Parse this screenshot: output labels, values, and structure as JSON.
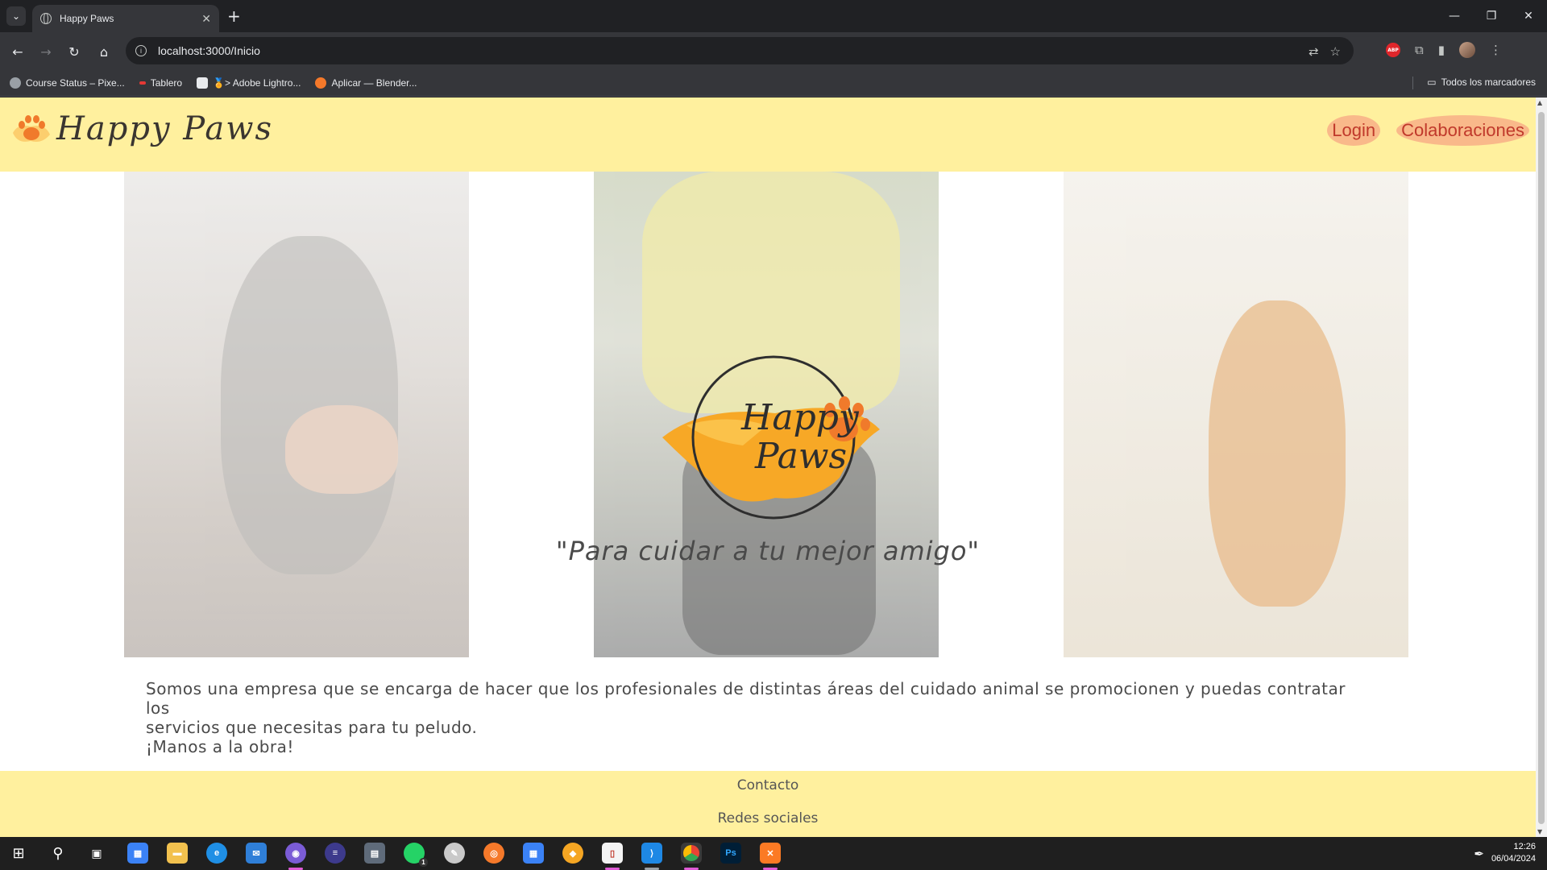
{
  "browser": {
    "tab_title": "Happy Paws",
    "url": "localhost:3000/Inicio",
    "bookmarks": [
      {
        "label": "Course Status – Pixe...",
        "color": "#9aa0a6"
      },
      {
        "label": "Tablero",
        "color": "#e53935"
      },
      {
        "label": "🏅> Adobe Lightro...",
        "color": "#e8eaed"
      },
      {
        "label": "Aplicar — Blender...",
        "color": "#f5792a"
      }
    ],
    "all_bookmarks": "Todos los marcadores"
  },
  "site": {
    "logo_text": "Happy Paws",
    "nav": {
      "login": "Login",
      "colaboraciones": "Colaboraciones"
    },
    "center_logo": {
      "line1": "Happy",
      "line2": "Paws"
    },
    "tagline": "\"Para cuidar a tu mejor amigo\"",
    "about": {
      "line1": "Somos una empresa que se encarga de hacer que los profesionales de distintas áreas del cuidado animal se promocionen y puedas contratar los",
      "line2": "servicios que necesitas para tu peludo.",
      "line3": "¡Manos a la obra!"
    },
    "footer": {
      "contacto": "Contacto",
      "redes": "Redes sociales"
    },
    "colors": {
      "header_bg": "#fff09e",
      "accent": "#c0392b",
      "pill": "#f9b98a",
      "logo_orange": "#f7a826"
    }
  },
  "taskbar": {
    "time": "12:26",
    "date": "06/04/2024",
    "whatsapp_badge": "1",
    "photoshop_label": "Ps"
  }
}
